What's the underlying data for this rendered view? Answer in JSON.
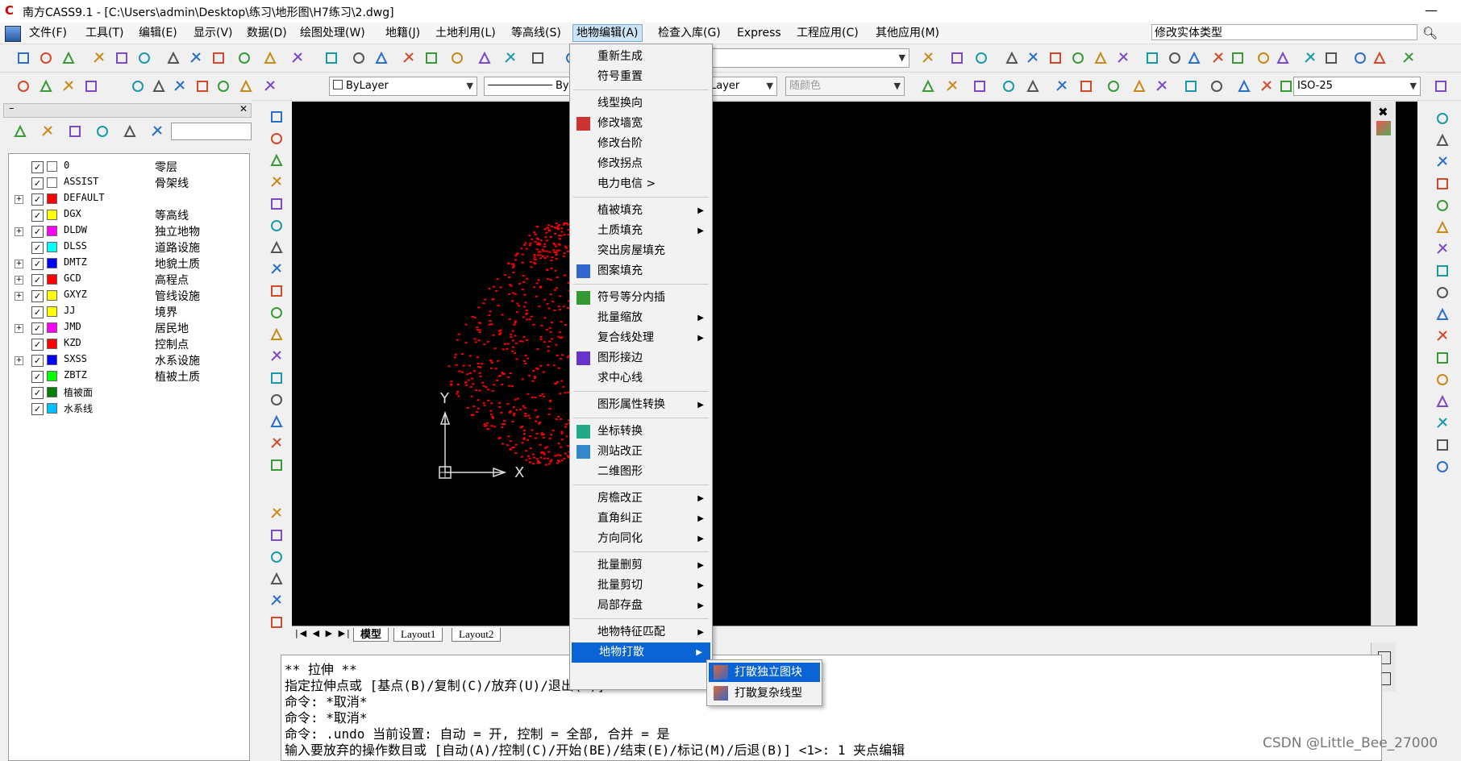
{
  "window": {
    "title": "南方CASS9.1 - [C:\\Users\\admin\\Desktop\\练习\\地形图\\H7练习\\2.dwg]",
    "minimize_glyph": "—"
  },
  "menubar": {
    "items": [
      {
        "label": "文件(F)"
      },
      {
        "label": "工具(T)"
      },
      {
        "label": "编辑(E)"
      },
      {
        "label": "显示(V)"
      },
      {
        "label": "数据(D)"
      },
      {
        "label": "绘图处理(W)"
      },
      {
        "label": "地籍(J)"
      },
      {
        "label": "土地利用(L)"
      },
      {
        "label": "等高线(S)"
      },
      {
        "label": "地物编辑(A)"
      },
      {
        "label": "检查入库(G)"
      },
      {
        "label": "Express"
      },
      {
        "label": "工程应用(C)"
      },
      {
        "label": "其他应用(M)"
      }
    ],
    "search_value": "修改实体类型"
  },
  "toolbar3": {
    "layer_combo": "ByLayer",
    "linetype_combo": "By",
    "linetype_right": "Layer",
    "color_combo": "随颜色",
    "dimstyle_combo": "ISO-25"
  },
  "layers": [
    {
      "name": "0",
      "desc": "零层",
      "color": "#ffffff",
      "expandable": false
    },
    {
      "name": "ASSIST",
      "desc": "骨架线",
      "color": "#ffffff",
      "expandable": false
    },
    {
      "name": "DEFAULT",
      "desc": "",
      "color": "#ff0000",
      "expandable": true
    },
    {
      "name": "DGX",
      "desc": "等高线",
      "color": "#ffff00",
      "expandable": false
    },
    {
      "name": "DLDW",
      "desc": "独立地物",
      "color": "#ff00ff",
      "expandable": true
    },
    {
      "name": "DLSS",
      "desc": "道路设施",
      "color": "#00ffff",
      "expandable": false
    },
    {
      "name": "DMTZ",
      "desc": "地貌土质",
      "color": "#0000ff",
      "expandable": true
    },
    {
      "name": "GCD",
      "desc": "高程点",
      "color": "#ff0000",
      "expandable": true
    },
    {
      "name": "GXYZ",
      "desc": "管线设施",
      "color": "#ffff00",
      "expandable": true
    },
    {
      "name": "JJ",
      "desc": "境界",
      "color": "#ffff00",
      "expandable": false
    },
    {
      "name": "JMD",
      "desc": "居民地",
      "color": "#ff00ff",
      "expandable": true
    },
    {
      "name": "KZD",
      "desc": "控制点",
      "color": "#ff0000",
      "expandable": false
    },
    {
      "name": "SXSS",
      "desc": "水系设施",
      "color": "#0000ff",
      "expandable": true
    },
    {
      "name": "ZBTZ",
      "desc": "植被土质",
      "color": "#00ff00",
      "expandable": false
    },
    {
      "name": "植被面",
      "desc": "",
      "color": "#008000",
      "expandable": false
    },
    {
      "name": "水系线",
      "desc": "",
      "color": "#00bfff",
      "expandable": false
    }
  ],
  "canvas": {
    "axis_y": "Y",
    "axis_x": "X"
  },
  "tabs": [
    {
      "label": "模型"
    },
    {
      "label": "Layout1"
    },
    {
      "label": "Layout2"
    }
  ],
  "command_lines": [
    "** 拉伸 **",
    "指定拉伸点或 [基点(B)/复制(C)/放弃(U)/退出(X)]:",
    "命令: *取消*",
    "命令: *取消*",
    "命令:  .undo 当前设置: 自动 = 开, 控制 = 全部, 合并 = 是",
    "输入要放弃的操作数目或 [自动(A)/控制(C)/开始(BE)/结束(E)/标记(M)/后退(B)] <1>: 1 夹点编辑"
  ],
  "watermark": "CSDN @Little_Bee_27000",
  "dropdown": {
    "groups": [
      [
        {
          "label": "重新生成",
          "sub": false,
          "icon": ""
        },
        {
          "label": "符号重置",
          "sub": false,
          "icon": ""
        }
      ],
      [
        {
          "label": "线型换向",
          "sub": false,
          "icon": ""
        },
        {
          "label": "修改墙宽",
          "sub": false,
          "icon": "wall-icon"
        },
        {
          "label": "修改台阶",
          "sub": false,
          "icon": ""
        },
        {
          "label": "修改拐点",
          "sub": false,
          "icon": ""
        },
        {
          "label": "电力电信 >",
          "sub": false,
          "icon": ""
        }
      ],
      [
        {
          "label": "植被填充",
          "sub": true,
          "icon": ""
        },
        {
          "label": "土质填充",
          "sub": true,
          "icon": ""
        },
        {
          "label": "突出房屋填充",
          "sub": false,
          "icon": ""
        },
        {
          "label": "图案填充",
          "sub": false,
          "icon": "hatch-icon"
        }
      ],
      [
        {
          "label": "符号等分内插",
          "sub": false,
          "icon": "interp-icon"
        },
        {
          "label": "批量缩放",
          "sub": true,
          "icon": ""
        },
        {
          "label": "复合线处理",
          "sub": true,
          "icon": ""
        },
        {
          "label": "图形接边",
          "sub": false,
          "icon": "edge-icon"
        },
        {
          "label": "求中心线",
          "sub": false,
          "icon": ""
        }
      ],
      [
        {
          "label": "图形属性转换",
          "sub": true,
          "icon": ""
        }
      ],
      [
        {
          "label": "坐标转换",
          "sub": false,
          "icon": "coord-icon"
        },
        {
          "label": "测站改正",
          "sub": false,
          "icon": "station-icon"
        },
        {
          "label": "二维图形",
          "sub": false,
          "icon": ""
        }
      ],
      [
        {
          "label": "房檐改正",
          "sub": true,
          "icon": ""
        },
        {
          "label": "直角纠正",
          "sub": true,
          "icon": ""
        },
        {
          "label": "方向同化",
          "sub": true,
          "icon": ""
        }
      ],
      [
        {
          "label": "批量删剪",
          "sub": true,
          "icon": ""
        },
        {
          "label": "批量剪切",
          "sub": true,
          "icon": ""
        },
        {
          "label": "局部存盘",
          "sub": true,
          "icon": ""
        }
      ],
      [
        {
          "label": "地物特征匹配",
          "sub": true,
          "icon": ""
        },
        {
          "label": "地物打散",
          "sub": true,
          "icon": ""
        }
      ]
    ]
  },
  "submenu": {
    "items": [
      {
        "label": "打散独立图块"
      },
      {
        "label": "打散复杂线型"
      }
    ]
  },
  "colors": {
    "highlight": "#0a64d6",
    "canvas": "#000000",
    "points": "#ff0000"
  }
}
